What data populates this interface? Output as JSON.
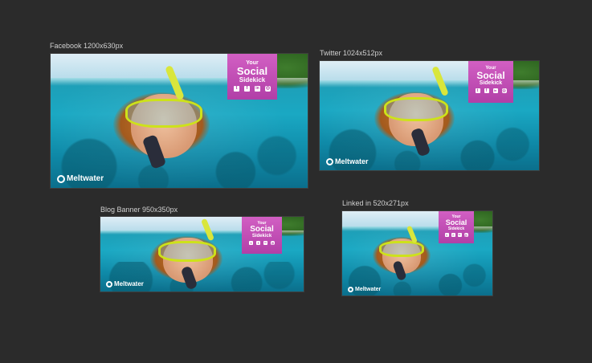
{
  "canvas": {
    "background": "#2b2b2b",
    "artboards": [
      {
        "id": "facebook",
        "label": "Facebook 1200x630px",
        "badge": {
          "line1": "Your",
          "line2": "Social",
          "line3": "Sidekick"
        },
        "social_icons": [
          "twitter-icon",
          "facebook-icon",
          "linkedin-icon",
          "instagram-icon"
        ],
        "logo_text": "Meltwater"
      },
      {
        "id": "twitter",
        "label": "Twitter 1024x512px",
        "badge": {
          "line1": "Your",
          "line2": "Social",
          "line3": "Sidekick"
        },
        "social_icons": [
          "twitter-icon",
          "facebook-icon",
          "linkedin-icon",
          "instagram-icon"
        ],
        "logo_text": "Meltwater"
      },
      {
        "id": "blog",
        "label": "Blog Banner 950x350px",
        "badge": {
          "line1": "Your",
          "line2": "Social",
          "line3": "Sidekick"
        },
        "social_icons": [
          "twitter-icon",
          "facebook-icon",
          "linkedin-icon",
          "instagram-icon"
        ],
        "logo_text": "Meltwater"
      },
      {
        "id": "linkedin",
        "label": "Linked in 520x271px",
        "badge": {
          "line1": "Your",
          "line2": "Social",
          "line3": "Sidekick"
        },
        "social_icons": [
          "twitter-icon",
          "facebook-icon",
          "linkedin-icon",
          "instagram-icon"
        ],
        "logo_text": "Meltwater"
      }
    ]
  },
  "colors": {
    "badge_top": "#d25fc3",
    "badge_bottom": "#b13fa7",
    "mask": "#cde21a",
    "water": "#1aa8c3"
  }
}
